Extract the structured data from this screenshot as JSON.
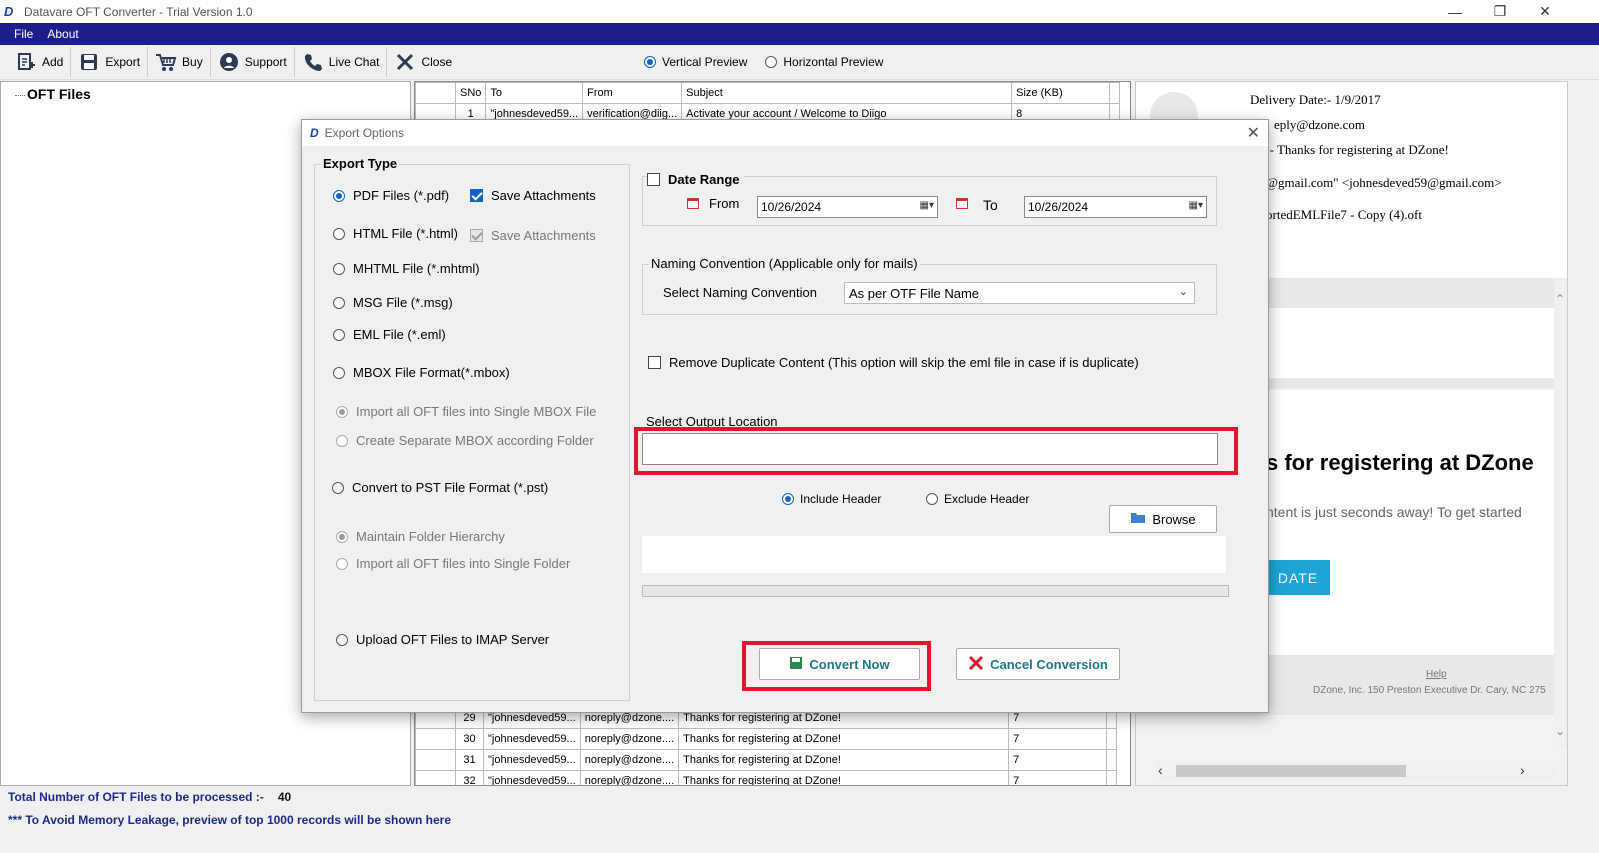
{
  "window": {
    "title": "Datavare OFT Converter - Trial Version 1.0",
    "app_icon": "datavare-logo-icon"
  },
  "menu": [
    "File",
    "About"
  ],
  "toolbar": {
    "buttons": [
      {
        "label": "Add",
        "icon": "add-file-icon"
      },
      {
        "label": "Export",
        "icon": "save-disk-icon"
      },
      {
        "label": "Buy",
        "icon": "cart-icon"
      },
      {
        "label": "Support",
        "icon": "support-icon"
      },
      {
        "label": "Live Chat",
        "icon": "phone-icon"
      },
      {
        "label": "Close",
        "icon": "close-x-icon"
      }
    ],
    "preview_vertical": "Vertical Preview",
    "preview_horizontal": "Horizontal Preview",
    "preview_selected": "Vertical Preview"
  },
  "tree": {
    "root": "OFT Files"
  },
  "grid": {
    "columns": [
      "SNo",
      "To",
      "From",
      "Subject",
      "Size (KB)"
    ],
    "top_rows": [
      {
        "sn": "1",
        "to": "\"johnesdeved59...",
        "from": "verification@diig...",
        "subject": "Activate your account / Welcome to Diigo",
        "size": "8"
      }
    ],
    "bottom_rows": [
      {
        "sn": "29",
        "to": "\"johnesdeved59...",
        "from": "noreply@dzone....",
        "subject": "Thanks for registering at DZone!",
        "size": "7"
      },
      {
        "sn": "30",
        "to": "\"johnesdeved59...",
        "from": "noreply@dzone....",
        "subject": "Thanks for registering at DZone!",
        "size": "7"
      },
      {
        "sn": "31",
        "to": "\"johnesdeved59...",
        "from": "noreply@dzone....",
        "subject": "Thanks for registering at DZone!",
        "size": "7"
      },
      {
        "sn": "32",
        "to": "\"johnesdeved59...",
        "from": "noreply@dzone....",
        "subject": "Thanks for registering at DZone!",
        "size": "7"
      }
    ]
  },
  "preview": {
    "delivery_date": "Delivery Date:- 1/9/2017",
    "from": "eply@dzone.com",
    "subject": ":- Thanks for registering at DZone!",
    "to": "@gmail.com\" <johnesdeved59@gmail.com>",
    "file": "ortedEMLFile7 - Copy (4).oft",
    "body_title": "s for registering at DZone",
    "body_text": "ntent is just seconds away! To get started",
    "cta": "DATE",
    "help": "Help",
    "address": "DZone, Inc. 150 Preston Executive Dr. Cary, NC 275"
  },
  "status": {
    "total_label": "Total Number of OFT Files to be processed :-",
    "total_value": "40",
    "note": "*** To Avoid Memory Leakage, preview of top 1000 records will be shown here"
  },
  "dialog": {
    "title": "Export Options",
    "export_type_legend": "Export Type",
    "export_types": {
      "pdf": "PDF Files (*.pdf)",
      "html": "HTML File  (*.html)",
      "mhtml": "MHTML File  (*.mhtml)",
      "msg": "MSG File (*.msg)",
      "eml": "EML File (*.eml)",
      "mbox": "MBOX File Format(*.mbox)",
      "mbox_single": "Import all OFT files into Single MBOX File",
      "mbox_separate": "Create Separate MBOX according Folder",
      "pst": "Convert to PST File Format (*.pst)",
      "pst_hierarchy": "Maintain Folder Hierarchy",
      "pst_single": "Import all OFT files into Single Folder",
      "imap": "Upload OFT Files to IMAP Server"
    },
    "selected_type": "pdf",
    "save_attachments_pdf": "Save Attachments",
    "save_attachments_html": "Save Attachments",
    "date_range": {
      "label": "Date Range",
      "from_label": "From",
      "from_value": "10/26/2024",
      "to_label": "To",
      "to_value": "10/26/2024"
    },
    "naming": {
      "legend": "Naming Convention (Applicable only for mails)",
      "label": "Select Naming Convention",
      "value": "As per OTF File Name"
    },
    "remove_duplicate": "Remove Duplicate Content (This option will skip the eml file in case if is duplicate)",
    "output": {
      "label": "Select Output Location",
      "value": ""
    },
    "include_header": "Include Header",
    "exclude_header": "Exclude Header",
    "header_selected": "include",
    "browse": "Browse",
    "convert": "Convert Now",
    "cancel": "Cancel Conversion",
    "highlight_color": "#e0162b"
  }
}
